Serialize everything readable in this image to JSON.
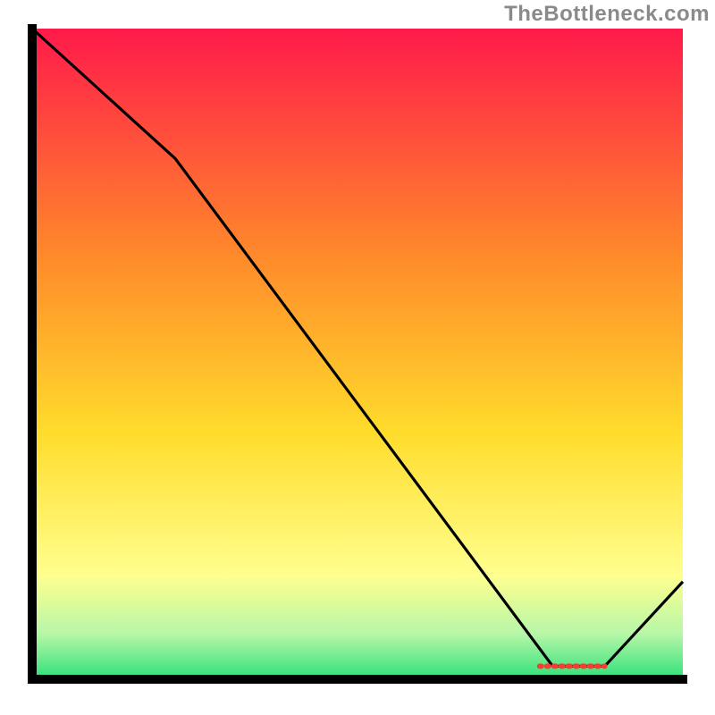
{
  "attribution": "TheBottleneck.com",
  "colors": {
    "gradient_top": "#ff1a4a",
    "gradient_upper_mid": "#ff8a2b",
    "gradient_mid": "#ffdc2b",
    "gradient_lower_yellow": "#ffff8e",
    "gradient_green_top": "#b7f7a8",
    "gradient_green_bottom": "#2fe07a",
    "axis": "#000000",
    "line": "#000000",
    "marker_fill": "#ff3b30",
    "marker_stroke": "#b82118"
  },
  "chart_data": {
    "type": "line",
    "title": "",
    "xlabel": "",
    "ylabel": "",
    "xlim": [
      0,
      100
    ],
    "ylim": [
      0,
      100
    ],
    "grid": false,
    "legend": false,
    "x": [
      0,
      22,
      80,
      88,
      100
    ],
    "values": [
      100,
      80,
      2,
      2,
      15
    ],
    "marker": {
      "x_start": 78,
      "x_end": 88,
      "y": 2
    },
    "annotations": []
  }
}
